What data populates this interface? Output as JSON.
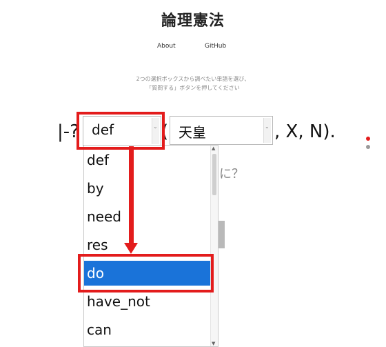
{
  "header": {
    "title": "論理憲法"
  },
  "nav": {
    "about": "About",
    "github": "GitHub"
  },
  "instructions": {
    "line1": "2つの選択ボックスから調べたい単語を選び、",
    "line2": "「質問する」ボタンを押してください"
  },
  "query": {
    "prefix": "|-?",
    "open_paren": "(",
    "suffix": ", X, N).",
    "left_select_value": "def",
    "right_select_value": "天皇"
  },
  "dropdown": {
    "options": [
      "def",
      "by",
      "need",
      "res",
      "do",
      "have_not",
      "can"
    ],
    "selected": "do"
  },
  "hint": {
    "text": "に？"
  },
  "colors": {
    "highlight": "#e31c1c",
    "selection": "#1a73d9"
  }
}
